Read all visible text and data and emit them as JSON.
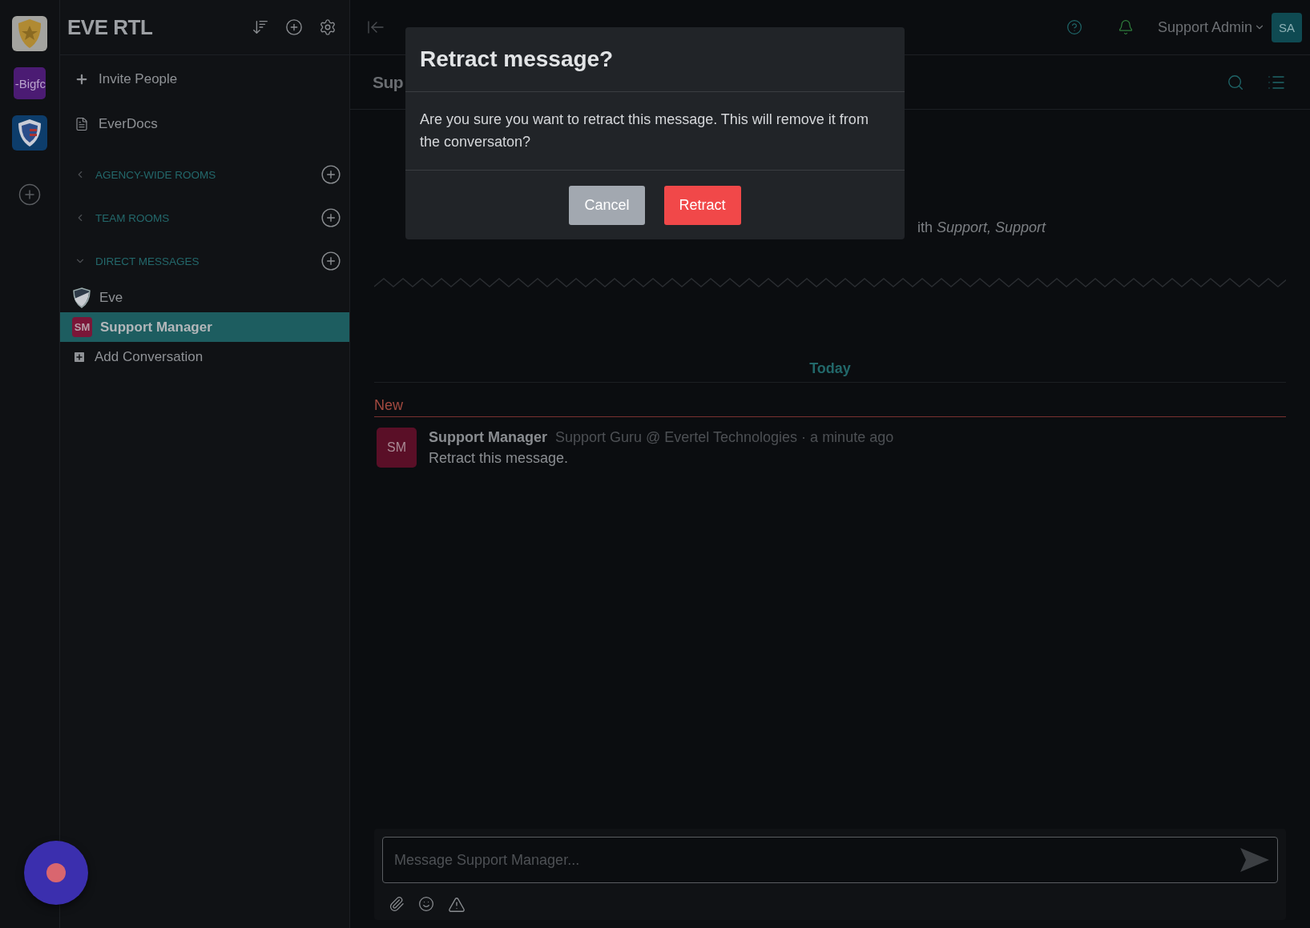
{
  "servers": [
    {
      "kind": "star-badge",
      "selected": true
    },
    {
      "kind": "text",
      "label": "-Bigfc",
      "selected": false
    },
    {
      "kind": "shield",
      "selected": false
    }
  ],
  "workspace": {
    "title": "EVE RTL"
  },
  "sidebar": {
    "links": [
      {
        "kind": "invite",
        "label": "Invite People"
      },
      {
        "kind": "docs",
        "label": "EverDocs"
      }
    ],
    "sections": [
      {
        "label": "AGENCY-WIDE ROOMS",
        "expanded": false
      },
      {
        "label": "TEAM ROOMS",
        "expanded": false
      },
      {
        "label": "DIRECT MESSAGES",
        "expanded": true,
        "items": [
          {
            "kind": "shield",
            "label": "Eve",
            "selected": false
          },
          {
            "kind": "initials",
            "initials": "SM",
            "label": "Support Manager",
            "selected": true
          },
          {
            "kind": "add",
            "label": "Add Conversation",
            "selected": false
          }
        ]
      }
    ]
  },
  "topbar": {
    "user": "Support Admin",
    "initials": "SA"
  },
  "channel": {
    "title": "Sup"
  },
  "intro": "ith *Support, Support*",
  "timeline": {
    "day": "Today",
    "new_label": "New",
    "messages": [
      {
        "initials": "SM",
        "author": "Support Manager",
        "meta": "Support Guru @ Evertel Technologies · a minute ago",
        "text": "Retract this message."
      }
    ]
  },
  "composer": {
    "placeholder": "Message Support Manager..."
  },
  "dialog": {
    "title": "Retract message?",
    "body": "Are you sure you want to retract this message. This will remove it from the conversaton?",
    "buttons": [
      {
        "kind": "secondary",
        "label": "Cancel"
      },
      {
        "kind": "danger",
        "label": "Retract"
      }
    ]
  }
}
